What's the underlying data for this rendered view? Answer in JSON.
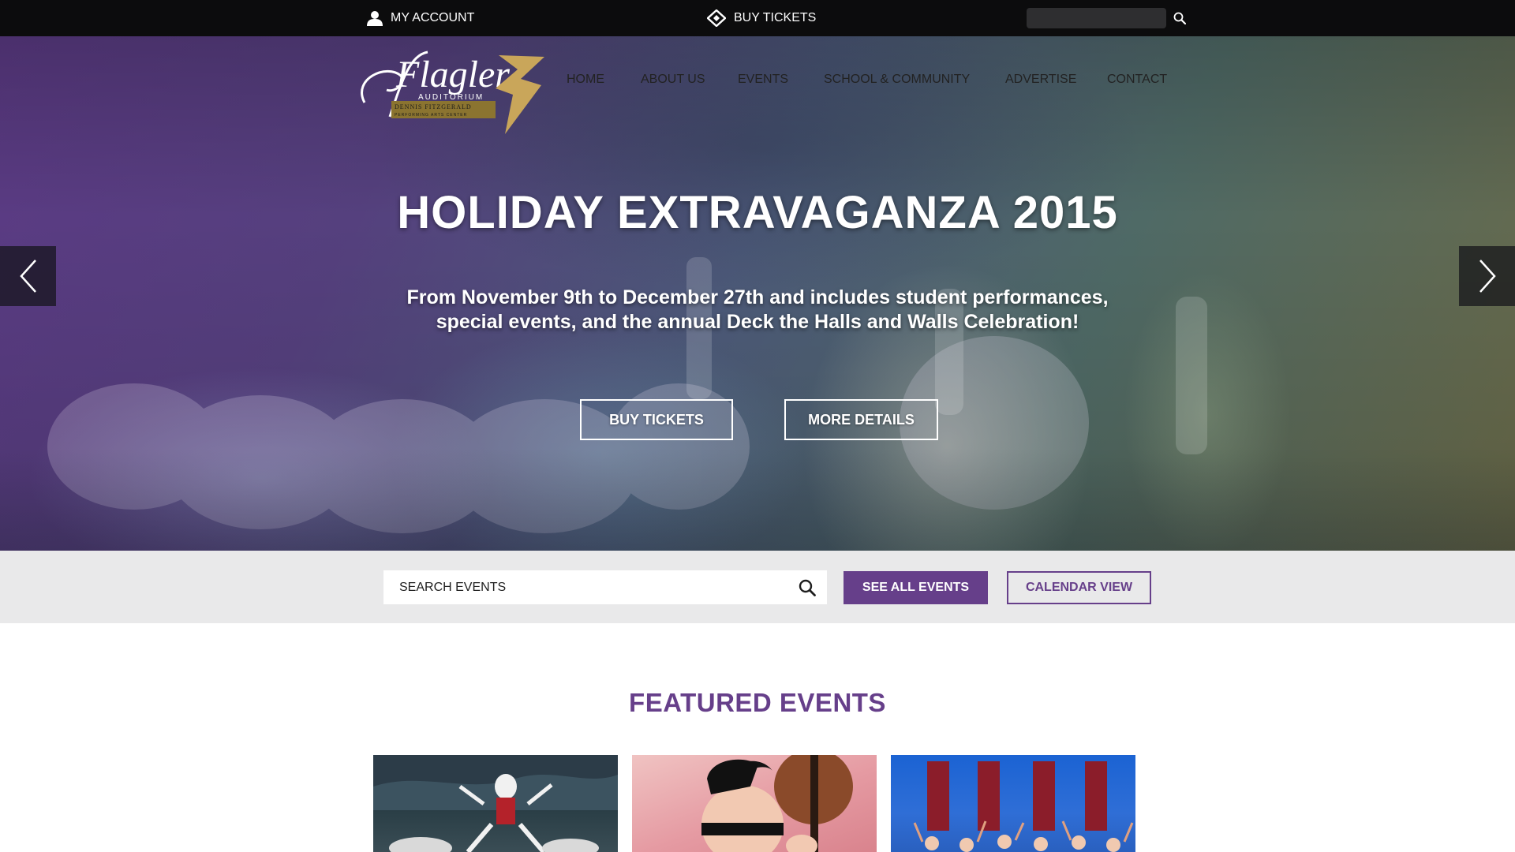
{
  "topbar": {
    "account_label": "MY ACCOUNT",
    "tickets_label": "BUY TICKETS",
    "search_placeholder": ""
  },
  "logo": {
    "alt": "Flagler Auditorium Dennis Fitzgerald Performing Arts Center",
    "name": "Flagler",
    "line1": "AUDITORIUM",
    "line2": "DENNIS FITZGERALD",
    "line3": "PERFORMING ARTS CENTER"
  },
  "nav": {
    "items": [
      {
        "label": "HOME"
      },
      {
        "label": "ABOUT US"
      },
      {
        "label": "EVENTS"
      },
      {
        "label": "SCHOOL & COMMUNITY"
      },
      {
        "label": "ADVERTISE"
      },
      {
        "label": "CONTACT"
      }
    ]
  },
  "hero": {
    "title": "HOLIDAY EXTRAVAGANZA 2015",
    "subtitle_line1": "From November 9th to December 27th and includes student performances,",
    "subtitle_line2": "special events, and the annual Deck the Halls and Walls Celebration!",
    "buy_label": "BUY TICKETS",
    "details_label": "MORE DETAILS",
    "prev_icon": "chevron-left-icon",
    "next_icon": "chevron-right-icon"
  },
  "event_search": {
    "placeholder": "SEARCH EVENTS",
    "see_all_label": "SEE ALL EVENTS",
    "calendar_label": "CALENDAR VIEW"
  },
  "featured": {
    "title": "FEATURED EVENTS",
    "cards": [
      {
        "image": "dancer-skeleton-costume"
      },
      {
        "image": "violinist-mohawk"
      },
      {
        "image": "drummers-blue-stage"
      }
    ]
  },
  "colors": {
    "topbar_bg": "#0c0c0d",
    "accent_purple": "#663f8a",
    "strip_bg": "#e9e9ea",
    "white": "#ffffff"
  }
}
